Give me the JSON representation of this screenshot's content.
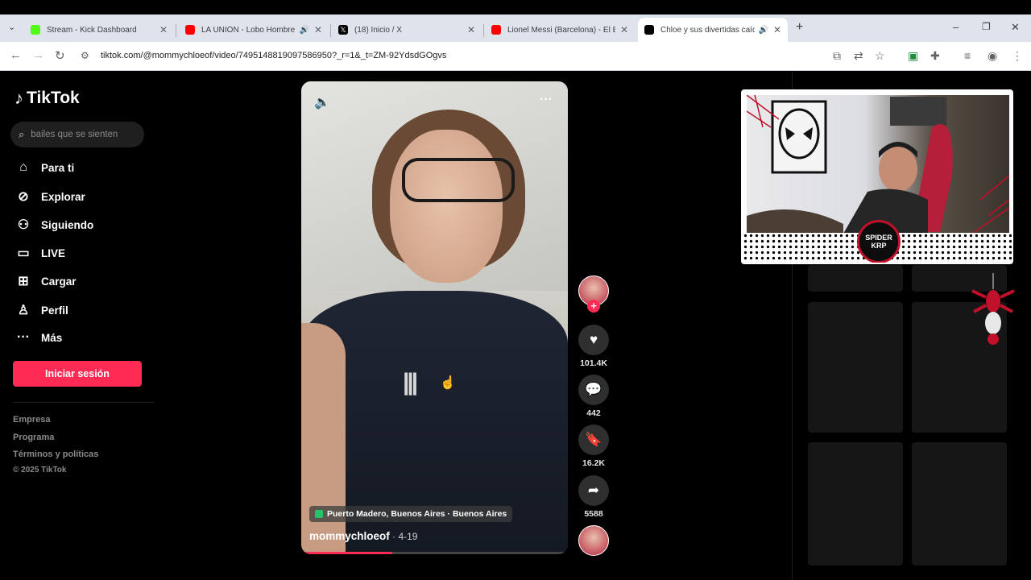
{
  "browser": {
    "tabs": [
      {
        "title": "Stream - Kick Dashboard",
        "favicon_color": "#53fc18",
        "audio": false,
        "active": false
      },
      {
        "title": "LA UNIÓN - Lobo Hombre",
        "favicon_color": "#ff0000",
        "audio": true,
        "active": false
      },
      {
        "title": "(18) Inicio / X",
        "favicon_color": "#000000",
        "audio": false,
        "active": false
      },
      {
        "title": "Lionel Messi (Barcelona) - El Ba",
        "favicon_color": "#ff0000",
        "audio": false,
        "active": false
      },
      {
        "title": "Chloe y sus divertidas caída",
        "favicon_color": "#000000",
        "audio": true,
        "active": true
      }
    ],
    "url": "tiktok.com/@mommychloeof/video/7495148819097586950?_r=1&_t=ZM-92YdsdGOgvs"
  },
  "sidebar": {
    "brand": "TikTok",
    "search_placeholder": "bailes que se sienten",
    "items": [
      {
        "label": "Para ti",
        "icon": "home-icon"
      },
      {
        "label": "Explorar",
        "icon": "compass-icon"
      },
      {
        "label": "Siguiendo",
        "icon": "following-icon"
      },
      {
        "label": "LIVE",
        "icon": "live-icon"
      },
      {
        "label": "Cargar",
        "icon": "upload-icon"
      },
      {
        "label": "Perfil",
        "icon": "profile-icon"
      },
      {
        "label": "Más",
        "icon": "more-icon"
      }
    ],
    "login_button": "Iniciar sesión",
    "footer": [
      "Empresa",
      "Programa",
      "Términos y políticas",
      "© 2025 TikTok"
    ]
  },
  "video": {
    "location": "Puerto Madero, Buenos Aires · Buenos Aires",
    "author": "mommychloeof",
    "date": " · 4-19",
    "progress": 0.34
  },
  "actions": {
    "likes": "101.4K",
    "comments": "442",
    "saves": "16.2K",
    "shares": "5588"
  },
  "overlay": {
    "badge_text": "SPIDER KRP"
  },
  "colors": {
    "accent": "#fe2c55",
    "background": "#000000"
  }
}
